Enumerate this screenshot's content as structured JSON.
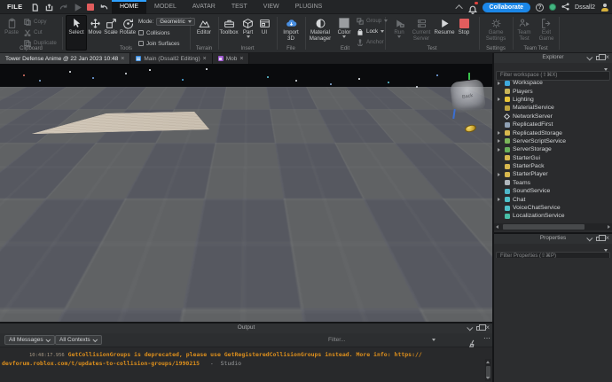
{
  "colors": {
    "accent_blue": "#1b87e8",
    "home_underline": "#2ea0ff",
    "stop_red": "#e25d5d",
    "warning_orange": "#dd8f1c",
    "timestamp_tan": "#a39582"
  },
  "titlebar": {
    "file_menu": "FILE",
    "menu_tabs": [
      "HOME",
      "MODEL",
      "AVATAR",
      "TEST",
      "VIEW",
      "PLUGINS"
    ],
    "qat_icons": [
      "new-file-icon",
      "open-icon",
      "redo-icon",
      "play-icon",
      "stop-icon",
      "undo-icon",
      "caret-down-icon"
    ],
    "collaborate_label": "Collaborate",
    "username": "Dssall2"
  },
  "ribbon": {
    "group_labels": [
      "Clipboard",
      "Tools",
      "Terrain",
      "Insert",
      "File",
      "Edit",
      "Test",
      "Settings",
      "Team Test"
    ],
    "clipboard": {
      "paste": "Paste",
      "copy": "Copy",
      "cut": "Cut",
      "duplicate": "Duplicate"
    },
    "tools": {
      "select": "Select",
      "move": "Move",
      "scale": "Scale",
      "rotate": "Rotate",
      "mode_label": "Mode:",
      "mode_value": "Geometric",
      "collisions": "Collisions",
      "join_surfaces": "Join Surfaces"
    },
    "terrain": {
      "editor": "Editor"
    },
    "insert": {
      "toolbox": "Toolbox",
      "part": "Part",
      "ui": "UI"
    },
    "file": {
      "import_line1": "Import",
      "import_line2": "3D"
    },
    "edit": {
      "material_line1": "Material",
      "material_line2": "Manager",
      "color": "Color",
      "group": "Group",
      "lock": "Lock",
      "anchor": "Anchor"
    },
    "test": {
      "run": "Run",
      "current_line1": "Current",
      "current_line2": "Server",
      "resume": "Resume",
      "stop": "Stop"
    },
    "settings": {
      "line1": "Game",
      "line2": "Settings"
    },
    "teamtest": {
      "team_line1": "Team",
      "team_line2": "Test",
      "exit_line1": "Exit",
      "exit_line2": "Game"
    }
  },
  "doc_tabs": [
    {
      "label": "Tower Defense Anime @ 22 Jan 2023 10:48",
      "close": "×"
    },
    {
      "label": "Main (Dssall2 Editing)",
      "close": "×",
      "icon": "script-icon"
    },
    {
      "label": "Mob",
      "close": "×",
      "icon": "model-icon"
    }
  ],
  "viewport": {
    "viewcube_label": "Back"
  },
  "explorer": {
    "title": "Explorer",
    "filter_placeholder": "Filter workspace (⇧⌘X)",
    "items": [
      {
        "label": "Workspace",
        "expandable": true,
        "icon_color": "#3fa9dd"
      },
      {
        "label": "Players",
        "expandable": false,
        "icon_color": "#c9b458"
      },
      {
        "label": "Lighting",
        "expandable": true,
        "icon_color": "#e8c53a"
      },
      {
        "label": "MaterialService",
        "expandable": false,
        "icon_color": "#bfa43e"
      },
      {
        "label": "NetworkServer",
        "expandable": false,
        "icon_color": "#d8dadc"
      },
      {
        "label": "ReplicatedFirst",
        "expandable": false,
        "icon_color": "#8fa0b4"
      },
      {
        "label": "ReplicatedStorage",
        "expandable": true,
        "icon_color": "#d8b84e"
      },
      {
        "label": "ServerScriptService",
        "expandable": true,
        "icon_color": "#7bb55a"
      },
      {
        "label": "ServerStorage",
        "expandable": true,
        "icon_color": "#69b05c"
      },
      {
        "label": "StarterGui",
        "expandable": false,
        "icon_color": "#d8b84e"
      },
      {
        "label": "StarterPack",
        "expandable": false,
        "icon_color": "#d8b84e"
      },
      {
        "label": "StarterPlayer",
        "expandable": true,
        "icon_color": "#d8b84e"
      },
      {
        "label": "Teams",
        "expandable": false,
        "icon_color": "#b0b6bc"
      },
      {
        "label": "SoundService",
        "expandable": false,
        "icon_color": "#4fb7c9"
      },
      {
        "label": "Chat",
        "expandable": true,
        "icon_color": "#4fc1c9"
      },
      {
        "label": "VoiceChatService",
        "expandable": false,
        "icon_color": "#4fc1c9"
      },
      {
        "label": "LocalizationService",
        "expandable": false,
        "icon_color": "#49bfa6"
      }
    ]
  },
  "properties": {
    "title": "Properties",
    "filter_placeholder": "Filter Properties (⇧⌘P)"
  },
  "output": {
    "title": "Output",
    "messages_filter": "All Messages",
    "contexts_filter": "All Contexts",
    "filter_placeholder": "Filter...",
    "log": {
      "timestamp": "10:48:17.956",
      "message_line1": "GetCollisionGroups is deprecated, please use GetRegisteredCollisionGroups instead. More info: https://",
      "message_line2": "devforum.roblox.com/t/updates-to-collision-groups/1990215",
      "separator": "-",
      "source": "Studio"
    }
  }
}
